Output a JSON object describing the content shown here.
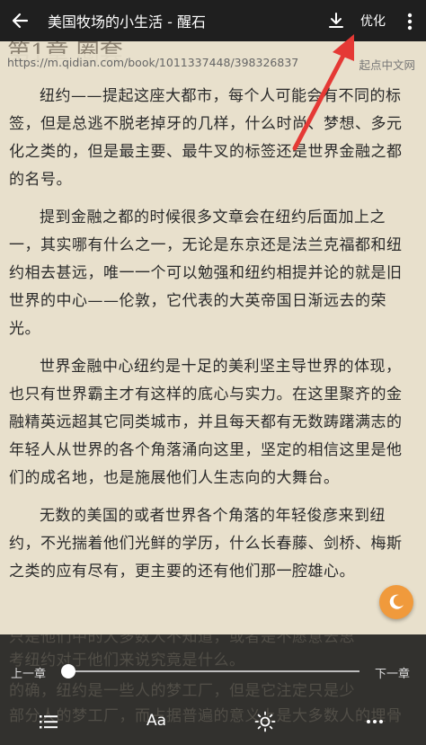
{
  "header": {
    "title": "美国牧场的小生活 - 醒石",
    "optimize_label": "优化"
  },
  "chapter_title": "第1章 圈套",
  "urlbar": {
    "url": "https://m.qidian.com/book/1011337448/398326837",
    "site": "起点中文网"
  },
  "paragraphs": [
    "纽约——提起这座大都市，每个人可能会有不同的标签，但是总逃不脱老掉牙的几样，什么时尚、梦想、多元化之类的，但是最主要、最牛叉的标签还是世界金融之都的名号。",
    "提到金融之都的时候很多文章会在纽约后面加上之一，其实哪有什么之一，无论是东京还是法兰克福都和纽约相去甚远，唯一一个可以勉强和纽约相提并论的就是旧世界的中心——伦敦，它代表的大英帝国日渐远去的荣光。",
    "世界金融中心纽约是十足的美利坚主导世界的体现，也只有世界霸主才有这样的底心与实力。在这里聚齐的金融精英远超其它同类城市，并且每天都有无数踌躇满志的年轻人从世界的各个角落涌向这里，坚定的相信这里是他们的成名地，也是施展他们人生志向的大舞台。",
    "无数的美国的或者世界各个角落的年轻俊彦来到纽约，不光揣着他们光鲜的学历，什么长春藤、剑桥、梅斯之类的应有尽有，更主要的还有他们那一腔雄心。"
  ],
  "ghost_lines": [
    "只是他们中的大多数人不知道，或者是不愿意去思",
    "考纽约对于他们来说究竟是什么。",
    "的确，纽约是一些人的梦工厂，但是它注定只是少",
    "部分人的梦工厂，而占据普遍的意义上是大多数人的埋骨"
  ],
  "bottom": {
    "prev_label": "上一章",
    "next_label": "下一章",
    "progress": 0.0,
    "font_label": "Aa"
  },
  "icons": [
    "back-arrow-icon",
    "download-icon",
    "more-vert-icon",
    "moon-icon",
    "list-icon",
    "brightness-icon",
    "more-horiz-icon"
  ],
  "colors": {
    "page_bg": "#e8e0cc",
    "toolbar_bg": "#1f1f1f",
    "night_button": "#f09a3c",
    "annotation_arrow": "#e53935"
  }
}
